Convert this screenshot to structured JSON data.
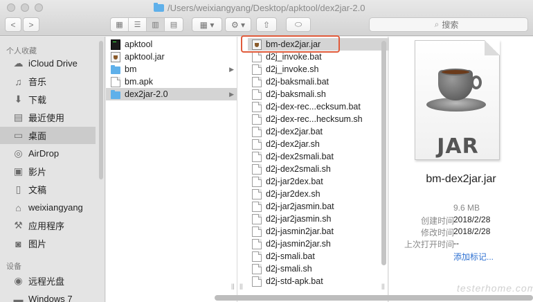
{
  "window": {
    "path": "/Users/weixiangyang/Desktop/apktool/dex2jar-2.0"
  },
  "toolbar": {
    "back": "<",
    "forward": ">",
    "view_modes": [
      "icon-view",
      "list-view",
      "column-view",
      "cover-flow-view"
    ],
    "search_placeholder": "搜索"
  },
  "sidebar": {
    "section_favorites": "个人收藏",
    "favorites": [
      {
        "label": "iCloud Drive",
        "icon": "cloud-icon"
      },
      {
        "label": "音乐",
        "icon": "music-icon"
      },
      {
        "label": "下载",
        "icon": "download-icon"
      },
      {
        "label": "最近使用",
        "icon": "recent-icon"
      },
      {
        "label": "桌面",
        "icon": "desktop-icon",
        "selected": true
      },
      {
        "label": "AirDrop",
        "icon": "airdrop-icon"
      },
      {
        "label": "影片",
        "icon": "movies-icon"
      },
      {
        "label": "文稿",
        "icon": "documents-icon"
      },
      {
        "label": "weixiangyang",
        "icon": "home-icon"
      },
      {
        "label": "应用程序",
        "icon": "applications-icon"
      },
      {
        "label": "图片",
        "icon": "pictures-icon"
      }
    ],
    "section_devices": "设备",
    "devices": [
      {
        "label": "远程光盘",
        "icon": "disc-icon"
      },
      {
        "label": "Windows 7",
        "icon": "drive-icon"
      }
    ]
  },
  "column1": [
    {
      "name": "apktool",
      "kind": "exec"
    },
    {
      "name": "apktool.jar",
      "kind": "jar"
    },
    {
      "name": "bm",
      "kind": "folder",
      "has_children": true
    },
    {
      "name": "bm.apk",
      "kind": "doc"
    },
    {
      "name": "dex2jar-2.0",
      "kind": "folder",
      "has_children": true,
      "selected": true
    }
  ],
  "column2": [
    {
      "name": "bm-dex2jar.jar",
      "kind": "jar",
      "selected": true
    },
    {
      "name": "d2j_invoke.bat",
      "kind": "doc"
    },
    {
      "name": "d2j_invoke.sh",
      "kind": "doc"
    },
    {
      "name": "d2j-baksmali.bat",
      "kind": "doc"
    },
    {
      "name": "d2j-baksmali.sh",
      "kind": "doc"
    },
    {
      "name": "d2j-dex-rec...ecksum.bat",
      "kind": "doc"
    },
    {
      "name": "d2j-dex-rec...hecksum.sh",
      "kind": "doc"
    },
    {
      "name": "d2j-dex2jar.bat",
      "kind": "doc"
    },
    {
      "name": "d2j-dex2jar.sh",
      "kind": "doc"
    },
    {
      "name": "d2j-dex2smali.bat",
      "kind": "doc"
    },
    {
      "name": "d2j-dex2smali.sh",
      "kind": "doc"
    },
    {
      "name": "d2j-jar2dex.bat",
      "kind": "doc"
    },
    {
      "name": "d2j-jar2dex.sh",
      "kind": "doc"
    },
    {
      "name": "d2j-jar2jasmin.bat",
      "kind": "doc"
    },
    {
      "name": "d2j-jar2jasmin.sh",
      "kind": "doc"
    },
    {
      "name": "d2j-jasmin2jar.bat",
      "kind": "doc"
    },
    {
      "name": "d2j-jasmin2jar.sh",
      "kind": "doc"
    },
    {
      "name": "d2j-smali.bat",
      "kind": "doc"
    },
    {
      "name": "d2j-smali.sh",
      "kind": "doc"
    },
    {
      "name": "d2j-std-apk.bat",
      "kind": "doc"
    }
  ],
  "preview": {
    "icon_label": "JAR",
    "filename": "bm-dex2jar.jar",
    "size": "9.6 MB",
    "created_label": "创建时间",
    "created": "2018/2/28",
    "modified_label": "修改时间",
    "modified": "2018/2/28",
    "opened_label": "上次打开时间",
    "opened": "--",
    "add_tags": "添加标记..."
  },
  "watermark": "testerhome.com",
  "colors": {
    "highlight_border": "#e05a3a",
    "folder": "#5fb0ea",
    "link": "#2c6fd1"
  }
}
